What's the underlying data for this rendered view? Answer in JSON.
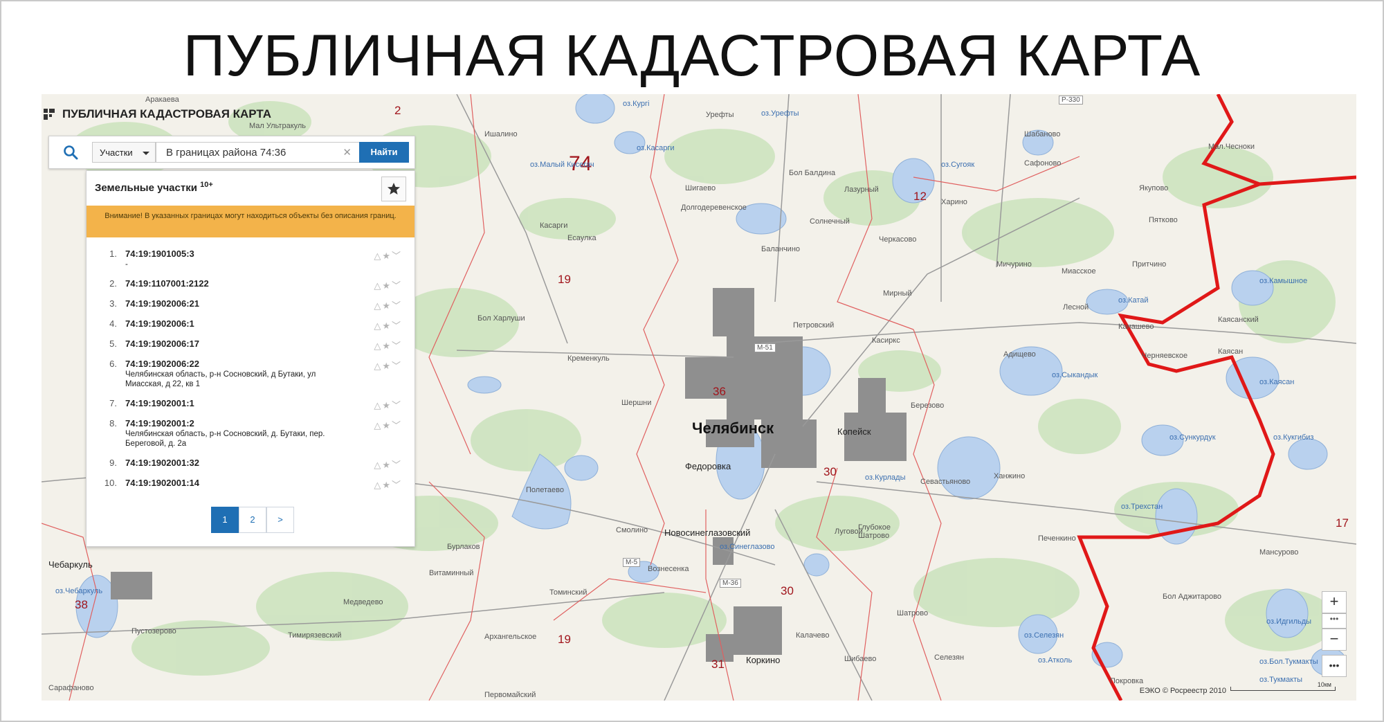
{
  "page_title": "ПУБЛИЧНАЯ КАДАСТРОВАЯ КАРТА",
  "app_title": "ПУБЛИЧНАЯ КАДАСТРОВАЯ КАРТА",
  "search": {
    "category": "Участки",
    "query": "В границах района 74:36",
    "button": "Найти"
  },
  "results": {
    "title": "Земельные участки",
    "count_badge": "10+",
    "warning": "Внимание! В указанных границах могут находиться объекты без описания границ.",
    "items": [
      {
        "n": "1.",
        "code": "74:19:1901005:3",
        "addr": "-"
      },
      {
        "n": "2.",
        "code": "74:19:1107001:2122",
        "addr": ""
      },
      {
        "n": "3.",
        "code": "74:19:1902006:21",
        "addr": ""
      },
      {
        "n": "4.",
        "code": "74:19:1902006:1",
        "addr": ""
      },
      {
        "n": "5.",
        "code": "74:19:1902006:17",
        "addr": ""
      },
      {
        "n": "6.",
        "code": "74:19:1902006:22",
        "addr": "Челябинская область, р-н Сосновский, д Бутаки, ул Миасская, д 22, кв 1"
      },
      {
        "n": "7.",
        "code": "74:19:1902001:1",
        "addr": ""
      },
      {
        "n": "8.",
        "code": "74:19:1902001:2",
        "addr": "Челябинская область, р-н Сосновский, д. Бутаки, пер. Береговой, д. 2а"
      },
      {
        "n": "9.",
        "code": "74:19:1902001:32",
        "addr": ""
      },
      {
        "n": "10.",
        "code": "74:19:1902001:14",
        "addr": ""
      }
    ],
    "pages": [
      "1",
      "2",
      ">"
    ]
  },
  "map": {
    "city": "Челябинск",
    "towns": [
      "Копейск",
      "Коркино",
      "Новосинеглазовский",
      "Чебаркуль",
      "Федоровка"
    ],
    "lakes": [
      "оз.Кургi",
      "оз.Урефты",
      "оз.Малый Кисегач",
      "оз.Сугояк",
      "оз.Касарги",
      "оз.Катай",
      "оз.Камышное",
      "оз.Сыкандык",
      "оз.Каясан",
      "оз.Сункурдук",
      "оз.Кукгибиз",
      "оз.Курлады",
      "оз.Трехстан",
      "оз.Синеглазово",
      "оз.Чебаркуль",
      "оз.Селезян",
      "оз.Атколь",
      "оз.Бол.Тукмакты",
      "оз.Тукмакты",
      "оз.Идгильды"
    ],
    "region_numbers": [
      "74",
      "2",
      "12",
      "19",
      "36",
      "30",
      "31",
      "19",
      "30",
      "38",
      "17"
    ],
    "villages": [
      "Аракаева",
      "Мал Ультракуль",
      "Ишалино",
      "Урефты",
      "Бол Балдина",
      "Шигаево",
      "Долгодеревенское",
      "Есаулка",
      "Мирный",
      "Шабаново",
      "Сафоново",
      "Мал.Чесноки",
      "Якупово",
      "Пятково",
      "Притчино",
      "Каясанский",
      "Канашево",
      "Каясан",
      "Бол Харлуши",
      "Касарги",
      "Кременкуль",
      "Шершни",
      "Березово",
      "Полетаево",
      "Смолино",
      "Луговой",
      "Глубокое",
      "Севастьяново",
      "Ханжино",
      "Печенкино",
      "Шатрово",
      "Вознесенка",
      "Архангельское",
      "Тимирязевский",
      "Медведево",
      "Калачево",
      "Шибаево",
      "Селезян",
      "Покровка",
      "Бол Аджитарово",
      "Мансурово",
      "Первомайский",
      "Сарафаново",
      "Пустозерово",
      "Томинский",
      "Витаминный",
      "Бурлаков",
      "Миасское",
      "Лесной",
      "Черняевское",
      "Адищево",
      "Шатрово",
      "Баланчино",
      "Петровский",
      "Касиркс",
      "Мичурино",
      "Черкасово",
      "Солнечный",
      "Лазурный",
      "Харино",
      "Бол Аджитарово"
    ],
    "roads": [
      "М-51",
      "М-5",
      "М-36",
      "Р-330"
    ],
    "attribution": "ЕЭКО © Росреестр 2010",
    "scale": "10км"
  }
}
